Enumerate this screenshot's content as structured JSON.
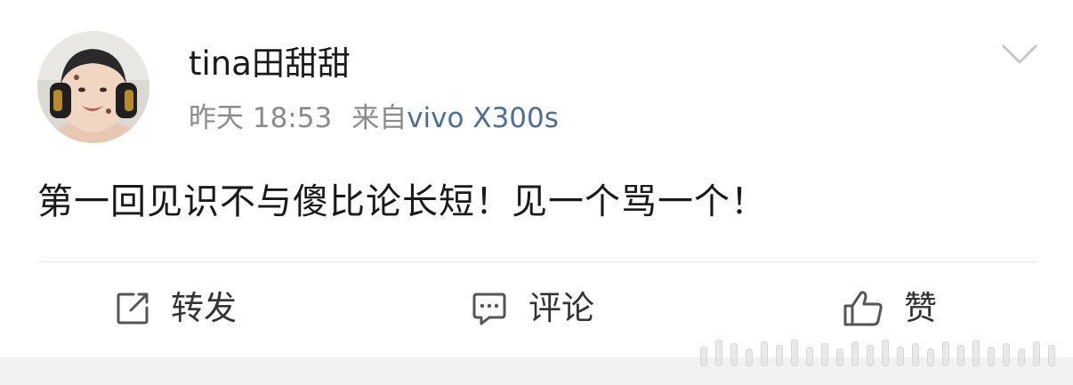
{
  "post": {
    "username": "tina田甜甜",
    "time": "昨天 18:53",
    "source_prefix": "来自",
    "device": "vivo X300s",
    "content": "第一回见识不与傻比论长短！见一个骂一个！"
  },
  "actions": {
    "repost_label": "转发",
    "comment_label": "评论",
    "like_label": "赞"
  },
  "icons": {
    "more": "chevron-down-icon",
    "repost": "share-square-icon",
    "comment": "comment-bubble-icon",
    "like": "thumbs-up-icon"
  },
  "colors": {
    "text": "#1a1a1a",
    "meta": "#8b8b8b",
    "device_link": "#4d6e9a",
    "divider": "#e8e8e8",
    "footer_bg": "#f2f2f2"
  }
}
